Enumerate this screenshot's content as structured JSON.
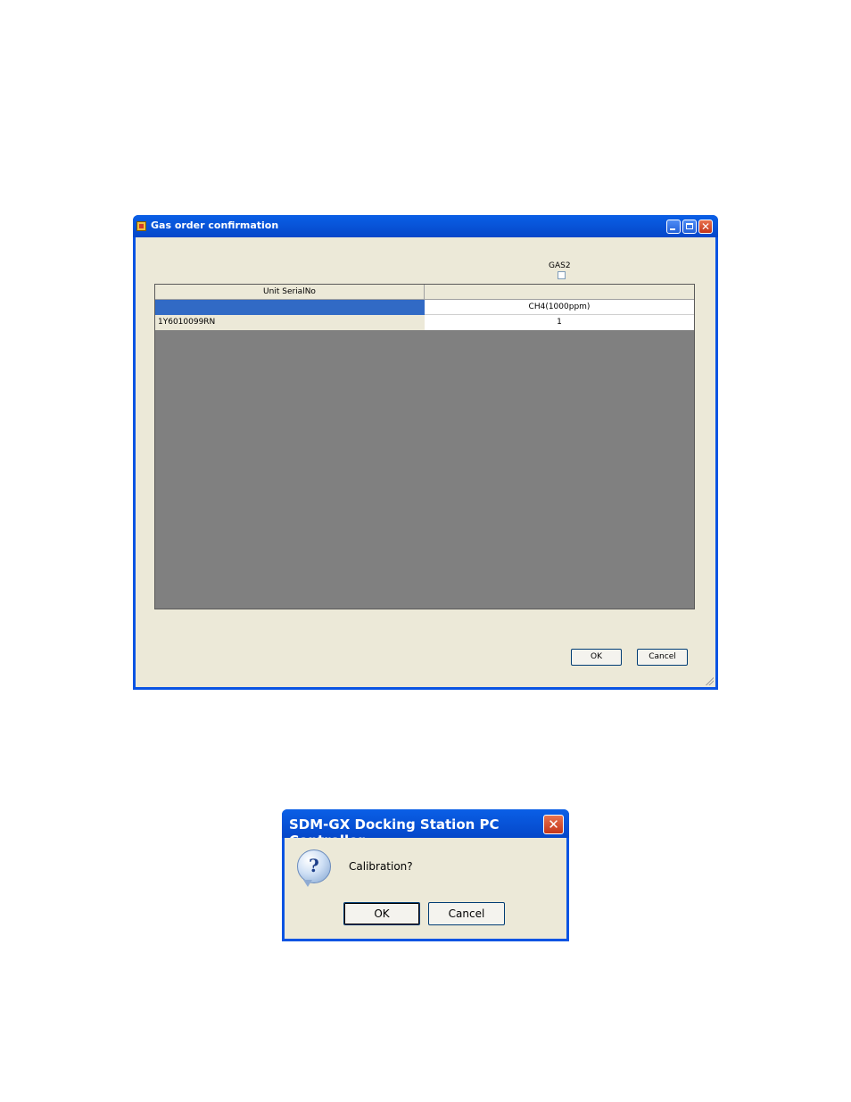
{
  "gas_window": {
    "title": "Gas order confirmation",
    "gas2_label": "GAS2",
    "grid": {
      "header": [
        "Unit SerialNo",
        ""
      ],
      "rows": [
        [
          "",
          "CH4(1000ppm)"
        ],
        [
          "1Y6010099RN",
          "1"
        ]
      ]
    },
    "ok_label": "OK",
    "cancel_label": "Cancel",
    "icons": [
      "app-icon",
      "minimize-icon",
      "maximize-icon",
      "close-icon",
      "resize-grip-icon"
    ]
  },
  "message_box": {
    "title": "SDM-GX Docking Station PC Controller",
    "close_glyph": "✕",
    "question_glyph": "?",
    "message": "Calibration?",
    "ok_label": "OK",
    "cancel_label": "Cancel",
    "icons": [
      "question-icon",
      "close-icon"
    ]
  },
  "colors": {
    "titlebar": "#0a54e3",
    "window_face": "#ece9d8",
    "selection": "#316ac5",
    "grid_background": "#808080"
  }
}
